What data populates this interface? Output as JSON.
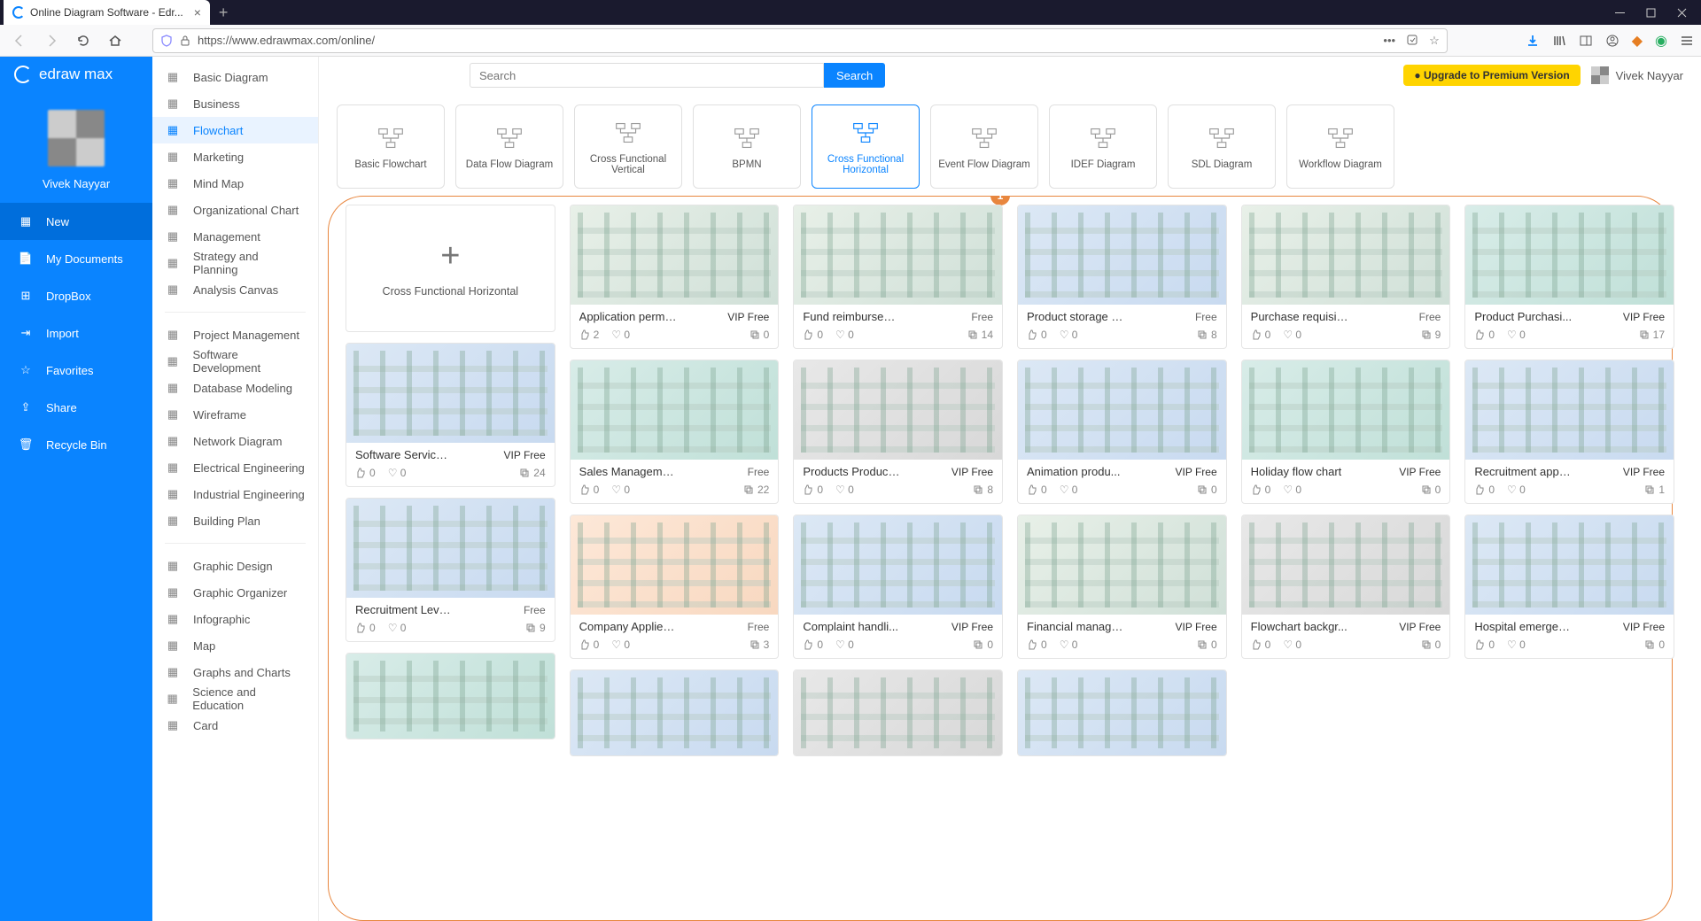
{
  "browser": {
    "tab_title": "Online Diagram Software - Edr...",
    "url": "https://www.edrawmax.com/online/"
  },
  "brand": "edraw max",
  "profile_name": "Vivek Nayyar",
  "leftnav": [
    {
      "label": "New",
      "active": true
    },
    {
      "label": "My Documents"
    },
    {
      "label": "DropBox"
    },
    {
      "label": "Import"
    },
    {
      "label": "Favorites"
    },
    {
      "label": "Share"
    },
    {
      "label": "Recycle Bin"
    }
  ],
  "categories_a": [
    {
      "label": "Basic Diagram"
    },
    {
      "label": "Business"
    },
    {
      "label": "Flowchart",
      "sel": true
    },
    {
      "label": "Marketing"
    },
    {
      "label": "Mind Map"
    },
    {
      "label": "Organizational Chart"
    },
    {
      "label": "Management"
    },
    {
      "label": "Strategy and Planning"
    },
    {
      "label": "Analysis Canvas"
    }
  ],
  "categories_b": [
    {
      "label": "Project Management"
    },
    {
      "label": "Software Development"
    },
    {
      "label": "Database Modeling"
    },
    {
      "label": "Wireframe"
    },
    {
      "label": "Network Diagram"
    },
    {
      "label": "Electrical Engineering"
    },
    {
      "label": "Industrial Engineering"
    },
    {
      "label": "Building Plan"
    }
  ],
  "categories_c": [
    {
      "label": "Graphic Design"
    },
    {
      "label": "Graphic Organizer"
    },
    {
      "label": "Infographic"
    },
    {
      "label": "Map"
    },
    {
      "label": "Graphs and Charts"
    },
    {
      "label": "Science and Education"
    },
    {
      "label": "Card"
    }
  ],
  "search": {
    "placeholder": "Search",
    "button": "Search"
  },
  "upgrade_label": "● Upgrade to Premium Version",
  "user_name": "Vivek Nayyar",
  "types": [
    {
      "label": "Basic Flowchart"
    },
    {
      "label": "Data Flow Diagram"
    },
    {
      "label": "Cross Functional Vertical"
    },
    {
      "label": "BPMN"
    },
    {
      "label": "Cross Functional Horizontal",
      "sel": true
    },
    {
      "label": "Event Flow Diagram"
    },
    {
      "label": "IDEF Diagram"
    },
    {
      "label": "SDL Diagram"
    },
    {
      "label": "Workflow Diagram"
    }
  ],
  "ring_badge": "1",
  "new_card_label": "Cross Functional Horizontal",
  "col0": [
    {
      "title": "Software Service ...",
      "badge": "VIP Free",
      "vip": true,
      "likes": "0",
      "favs": "0",
      "copies": "24",
      "thumb": "blue"
    },
    {
      "title": "Recruitment Level Cr...",
      "badge": "Free",
      "likes": "0",
      "favs": "0",
      "copies": "9",
      "thumb": "blue"
    }
  ],
  "grid": [
    [
      {
        "title": "Application permi...",
        "badge": "VIP Free",
        "vip": true,
        "likes": "2",
        "favs": "0",
        "copies": "0",
        "thumb": ""
      },
      {
        "title": "Fund reimbursement ...",
        "badge": "Free",
        "likes": "0",
        "favs": "0",
        "copies": "14",
        "thumb": ""
      },
      {
        "title": "Product storage flow ...",
        "badge": "Free",
        "likes": "0",
        "favs": "0",
        "copies": "8",
        "thumb": "blue"
      },
      {
        "title": "Purchase requisition ...",
        "badge": "Free",
        "likes": "0",
        "favs": "0",
        "copies": "9",
        "thumb": ""
      },
      {
        "title": "Product Purchasi...",
        "badge": "VIP Free",
        "vip": true,
        "likes": "0",
        "favs": "0",
        "copies": "17",
        "thumb": "teal"
      }
    ],
    [
      {
        "title": "Sales Management C...",
        "badge": "Free",
        "likes": "0",
        "favs": "0",
        "copies": "22",
        "thumb": "teal"
      },
      {
        "title": "Products Producti...",
        "badge": "VIP Free",
        "vip": true,
        "likes": "0",
        "favs": "0",
        "copies": "8",
        "thumb": "grey"
      },
      {
        "title": "Animation produ...",
        "badge": "VIP Free",
        "vip": true,
        "likes": "0",
        "favs": "0",
        "copies": "0",
        "thumb": "blue"
      },
      {
        "title": "Holiday flow chart",
        "badge": "VIP Free",
        "vip": true,
        "likes": "0",
        "favs": "0",
        "copies": "0",
        "thumb": "teal"
      },
      {
        "title": "Recruitment appli...",
        "badge": "VIP Free",
        "vip": true,
        "likes": "0",
        "favs": "0",
        "copies": "1",
        "thumb": "blue"
      }
    ],
    [
      {
        "title": "Company Applies To ...",
        "badge": "Free",
        "likes": "0",
        "favs": "0",
        "copies": "3",
        "thumb": "orange"
      },
      {
        "title": "Complaint handli...",
        "badge": "VIP Free",
        "vip": true,
        "likes": "0",
        "favs": "0",
        "copies": "0",
        "thumb": "blue"
      },
      {
        "title": "Financial manage...",
        "badge": "VIP Free",
        "vip": true,
        "likes": "0",
        "favs": "0",
        "copies": "0",
        "thumb": ""
      },
      {
        "title": "Flowchart backgr...",
        "badge": "VIP Free",
        "vip": true,
        "likes": "0",
        "favs": "0",
        "copies": "0",
        "thumb": "grey"
      },
      {
        "title": "Hospital emergen...",
        "badge": "VIP Free",
        "vip": true,
        "likes": "0",
        "favs": "0",
        "copies": "0",
        "thumb": "blue"
      }
    ]
  ]
}
